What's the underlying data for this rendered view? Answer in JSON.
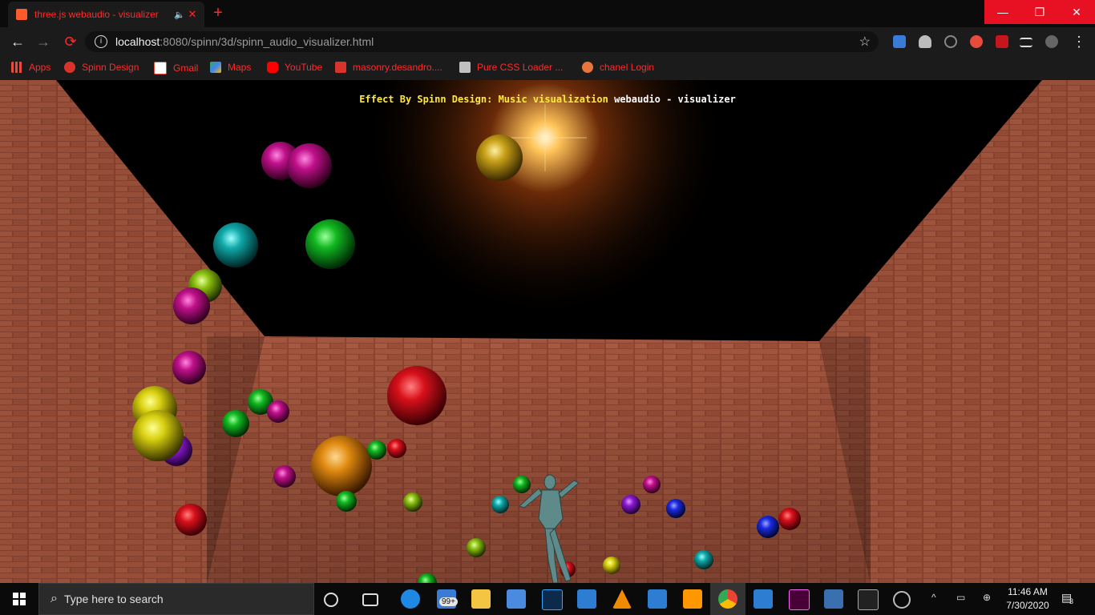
{
  "browser": {
    "tab": {
      "title": "three.js webaudio - visualizer"
    },
    "address": {
      "host": "localhost",
      "path": ":8080/spinn/3d/spinn_audio_visualizer.html"
    },
    "bookmarks": [
      {
        "label": "Apps",
        "color": "#e84b3c"
      },
      {
        "label": "Spinn Design",
        "color": "#d9342b"
      },
      {
        "label": "Gmail",
        "color": "#e84b3c"
      },
      {
        "label": "Maps",
        "color": "#34a853"
      },
      {
        "label": "YouTube",
        "color": "#ff0000"
      },
      {
        "label": "masonry.desandro....",
        "color": "#d9342b"
      },
      {
        "label": "Pure CSS Loader ...",
        "color": "#c0c0c0"
      },
      {
        "label": "chanel Login",
        "color": "#e8763a"
      }
    ]
  },
  "page": {
    "caption": {
      "part1": "Effect By Spinn Design: Music visualization",
      "part2": " webaudio - visualizer"
    }
  },
  "taskbar": {
    "search_placeholder": "Type here to search",
    "mail_badge": "99+",
    "time": "11:46 AM",
    "date": "7/30/2020",
    "notification_count": "3"
  },
  "colors": {
    "accent": "#ff2a2a",
    "brick": "#b0583a",
    "chrome_bg": "#1b1b1b",
    "win_close": "#e81123"
  }
}
